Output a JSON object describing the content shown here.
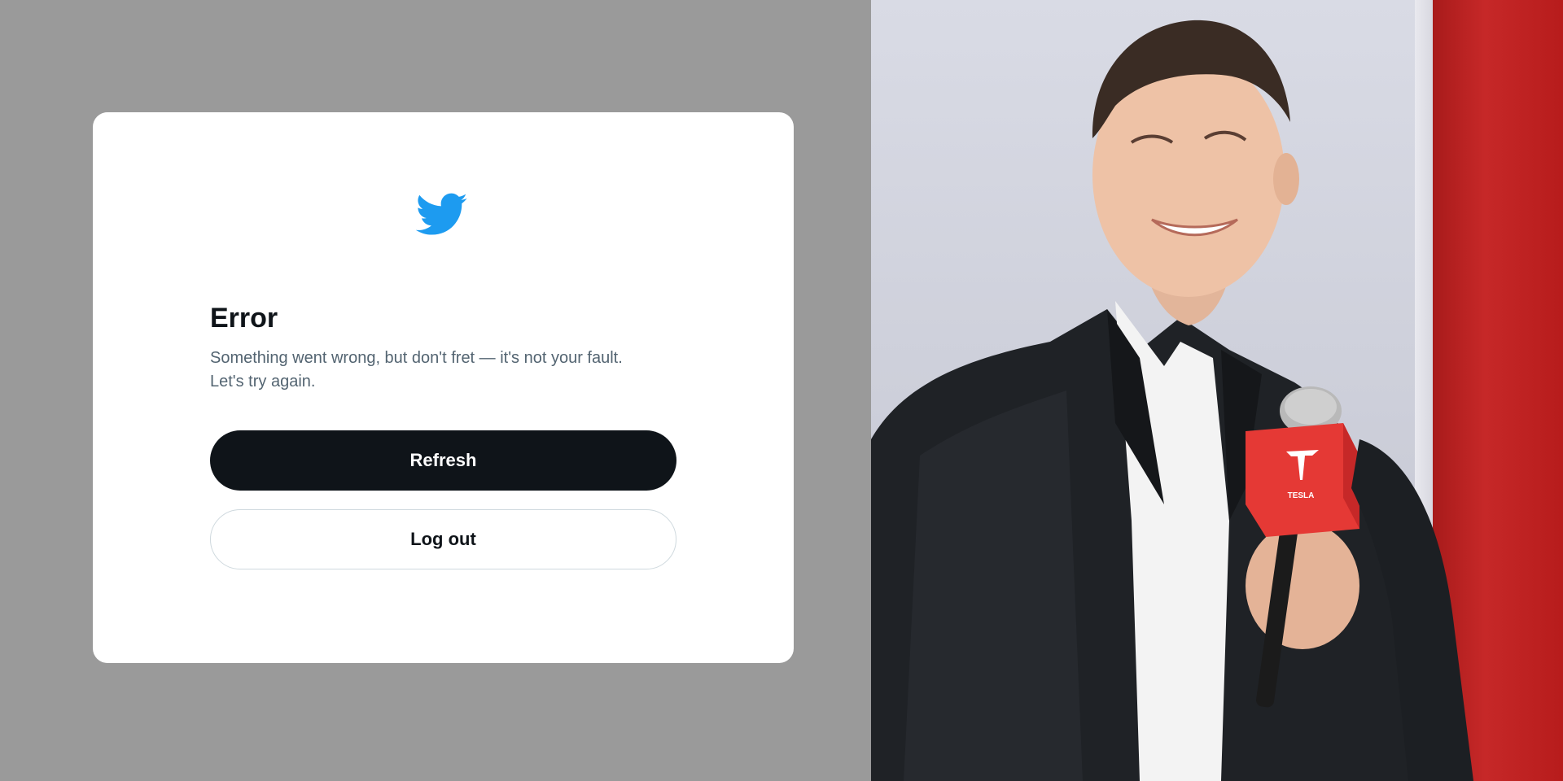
{
  "dialog": {
    "title": "Error",
    "message_line1": "Something went wrong, but don't fret — it's not your fault.",
    "message_line2": "Let's try again.",
    "refresh_label": "Refresh",
    "logout_label": "Log out",
    "brand_icon": "twitter-bird-icon",
    "brand_color": "#1d9bf0"
  },
  "photo": {
    "microphone_logo": "TESLA"
  }
}
